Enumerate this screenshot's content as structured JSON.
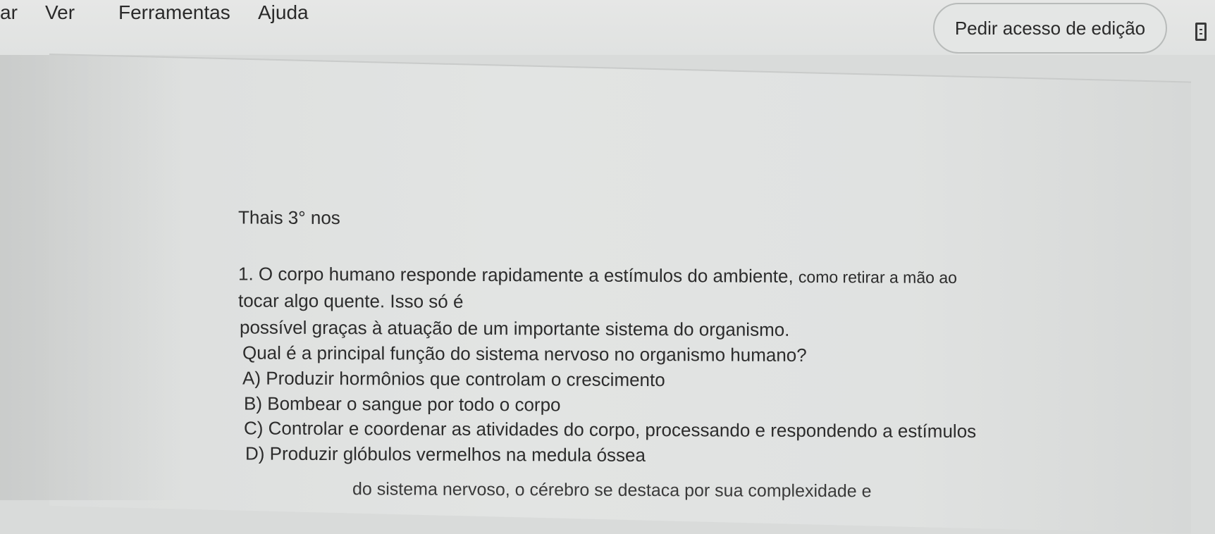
{
  "menu": {
    "items": [
      "ar",
      "Ver",
      "Ferramentas",
      "Ajuda"
    ]
  },
  "toolbar": {
    "edit_access_label": "Pedir acesso de edição",
    "right_icon": "document-outline-icon"
  },
  "document": {
    "student_line": "Thais  3° nos",
    "question": {
      "line1_main": "1. O corpo humano responde rapidamente a estímulos do ambiente, ",
      "line1_tail": "como retirar a mão ao",
      "line2": "tocar algo quente. Isso só é",
      "line3": "possível graças à atuação de um importante sistema do organismo.",
      "line4": "Qual é a principal função do sistema nervoso no organismo humano?"
    },
    "options": [
      "A) Produzir hormônios que controlam o crescimento",
      "B) Bombear o sangue por todo o corpo",
      "C) Controlar e coordenar as atividades do corpo, processando e respondendo a estímulos",
      "D) Produzir glóbulos vermelhos na medula óssea"
    ],
    "cut_off_line": "do sistema nervoso, o cérebro se destaca por sua complexidade e"
  },
  "colors": {
    "background": "#d9dbda",
    "text": "#2b2b2b"
  }
}
